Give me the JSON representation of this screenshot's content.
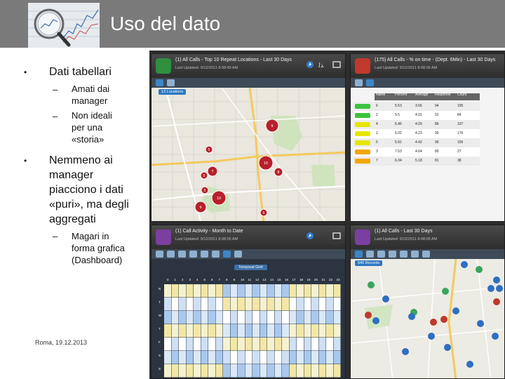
{
  "slide": {
    "title": "Uso del dato",
    "footer": "Roma, 19.12.2013",
    "bullets": [
      {
        "text": "Dati tabellari",
        "sub": [
          {
            "lines": [
              "Amati dai",
              "manager"
            ]
          },
          {
            "lines": [
              "Non ideali",
              "per una",
              "«storia»"
            ]
          }
        ]
      },
      {
        "lines": [
          "Nemmeno ai",
          "manager",
          "piacciono i dati",
          "«puri», ma degli",
          "aggregati"
        ],
        "sub": [
          {
            "lines": [
              "Magari in",
              "forma grafica",
              "(Dashboard)"
            ]
          }
        ]
      }
    ]
  },
  "dashboard": {
    "panels": {
      "top_left": {
        "title": "(1) All Calls - Top 10 Repeat Locations - Last 30 Days",
        "updated": "Last Updated: 9/12/2011 8:08:49 AM",
        "badge": "13 Locations",
        "icon_color": "#2e8f3f",
        "markers": [
          "9",
          "10",
          "7",
          "10",
          "9",
          "5",
          "5",
          "5",
          "5",
          "8"
        ]
      },
      "top_right": {
        "title": "(175) All Calls - % on time - (Dept. 6Min) - Last 30 Days",
        "updated": "Last Updated: 9/12/2011 8:08:05 AM",
        "icon_color": "#c0392b",
        "columns": [
          "Name",
          "Percent",
          "Average",
          "Response",
          "Count"
        ],
        "rows": [
          {
            "color": "#3cc43c",
            "cells": [
              "6",
              "5.53",
              "3.66",
              "94",
              "195"
            ]
          },
          {
            "color": "#3cc43c",
            "cells": [
              "2",
              "5.5",
              "4.01",
              "91",
              "84"
            ]
          },
          {
            "color": "#e6e600",
            "cells": [
              "4",
              "6.46",
              "4.09",
              "86",
              "107"
            ]
          },
          {
            "color": "#e6e600",
            "cells": [
              "1",
              "5.02",
              "4.23",
              "90",
              "176"
            ]
          },
          {
            "color": "#e6e600",
            "cells": [
              "5",
              "5.91",
              "4.42",
              "90",
              "156"
            ]
          },
          {
            "color": "#f0a800",
            "cells": [
              "3",
              "7.53",
              "4.64",
              "80",
              "27"
            ]
          },
          {
            "color": "#f0a800",
            "cells": [
              "7",
              "6.34",
              "5.18",
              "81",
              "38"
            ]
          }
        ]
      },
      "bottom_left": {
        "title": "(1) Call Activity - Month to Date",
        "updated": "Last Updated: 9/12/2011 8:08:05 AM",
        "grid_title": "Temporal Grid",
        "icon_color": "#7b3fa0",
        "hours": [
          "0",
          "1",
          "2",
          "3",
          "4",
          "5",
          "6",
          "7",
          "8",
          "9",
          "10",
          "11",
          "12",
          "13",
          "14",
          "15",
          "16",
          "17",
          "18",
          "19",
          "20",
          "21",
          "22",
          "23"
        ],
        "days": [
          "N",
          "T",
          "W",
          "T",
          "F",
          "S",
          "S"
        ]
      },
      "bottom_right": {
        "title": "(1) All Calls - Last 30 Days",
        "updated": "Last Updated: 9/12/2011 8:08:05 AM",
        "badge": "640 Records",
        "icon_color": "#7b3fa0"
      }
    }
  }
}
